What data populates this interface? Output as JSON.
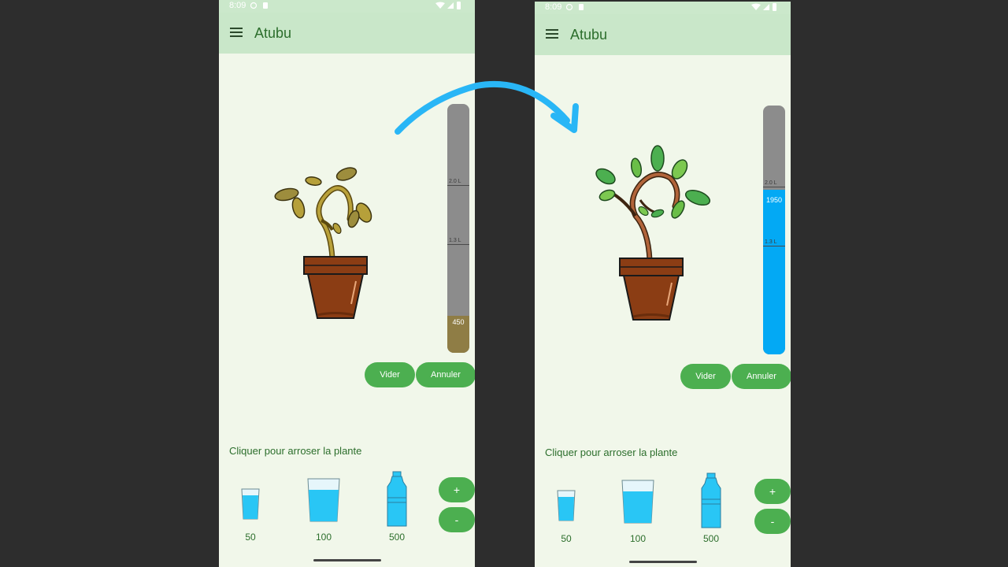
{
  "colors": {
    "accent": "#4caf50",
    "appbar": "#c9e7c9",
    "background": "#f1f7ea",
    "gauge_empty": "#8c8c8c",
    "gauge_dry": "#8f7d45",
    "gauge_water": "#03a9f4",
    "water": "#29c6f5",
    "arrow": "#29b6f6"
  },
  "before": {
    "status": {
      "time": "8:09"
    },
    "app": {
      "title": "Atubu"
    },
    "plant": {
      "state": "wilted"
    },
    "gauge": {
      "marks": [
        "2.0 L",
        "1.3 L"
      ],
      "value_label": "450",
      "fill_fraction": 0.15
    },
    "buttons": {
      "vider": "Vider",
      "annuler": "Annuler",
      "plus": "+",
      "minus": "-"
    },
    "hint": "Cliquer pour arroser la plante",
    "water_items": [
      {
        "label": "50",
        "icon": "small-glass-icon"
      },
      {
        "label": "100",
        "icon": "large-glass-icon"
      },
      {
        "label": "500",
        "icon": "bottle-icon"
      }
    ]
  },
  "after": {
    "status": {
      "time": "8:09"
    },
    "app": {
      "title": "Atubu"
    },
    "plant": {
      "state": "healthy"
    },
    "gauge": {
      "marks": [
        "2.0 L",
        "1.3 L"
      ],
      "value_label": "1950",
      "fill_fraction": 0.66
    },
    "buttons": {
      "vider": "Vider",
      "annuler": "Annuler",
      "plus": "+",
      "minus": "-"
    },
    "hint": "Cliquer pour arroser la plante",
    "water_items": [
      {
        "label": "50",
        "icon": "small-glass-icon"
      },
      {
        "label": "100",
        "icon": "large-glass-icon"
      },
      {
        "label": "500",
        "icon": "bottle-icon"
      }
    ]
  }
}
